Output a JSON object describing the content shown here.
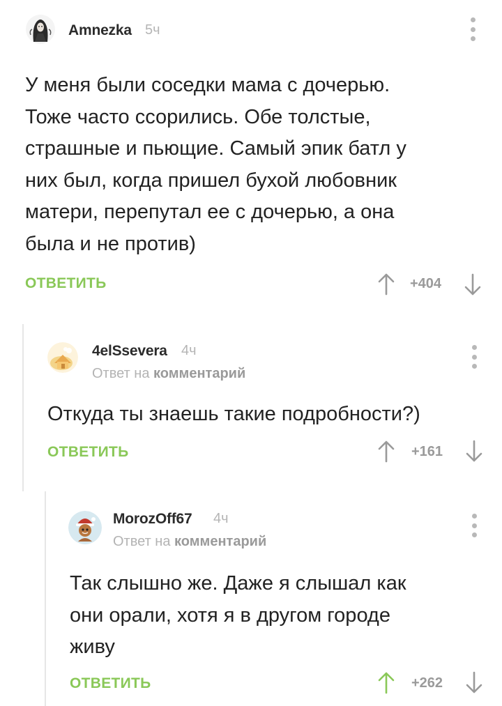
{
  "colors": {
    "accent_green": "#8ac858",
    "username": "#2b2b2b",
    "muted": "#b3b3b3",
    "thread_line": "#e6e6e6",
    "arrow_gray": "#9a9a9a"
  },
  "comments": [
    {
      "username": "Amnezka",
      "time": "5ч",
      "avatar_icon": "gothic-girl-avatar-icon",
      "body_lines": [
        "У меня были соседки мама с дочерью.",
        "Тоже часто ссорились. Обе толстые,",
        "страшные и пьющие. Самый эпик батл у",
        "них был, когда пришел бухой любовник",
        "матери, перепутал ее с дочерью, а она",
        "была и не против)"
      ],
      "reply_label": "ОТВЕТИТЬ",
      "rating": "+404",
      "upvoted": false
    },
    {
      "username": "4elSsevera",
      "time": "4ч",
      "avatar_icon": "cartoon-house-avatar-icon",
      "reply_prefix": "Ответ на",
      "reply_link": "комментарий",
      "body_lines": [
        "Откуда ты знаешь такие подробности?)"
      ],
      "reply_label": "ОТВЕТИТЬ",
      "rating": "+161",
      "upvoted": false
    },
    {
      "username": "MorozOff67",
      "time": "4ч",
      "avatar_icon": "gingerbread-santa-avatar-icon",
      "reply_prefix": "Ответ на",
      "reply_link": "комментарий",
      "body_lines": [
        "Так слышно же. Даже я слышал как",
        "они орали, хотя я в другом городе",
        "живу"
      ],
      "reply_label": "ОТВЕТИТЬ",
      "rating": "+262",
      "upvoted": true
    }
  ]
}
